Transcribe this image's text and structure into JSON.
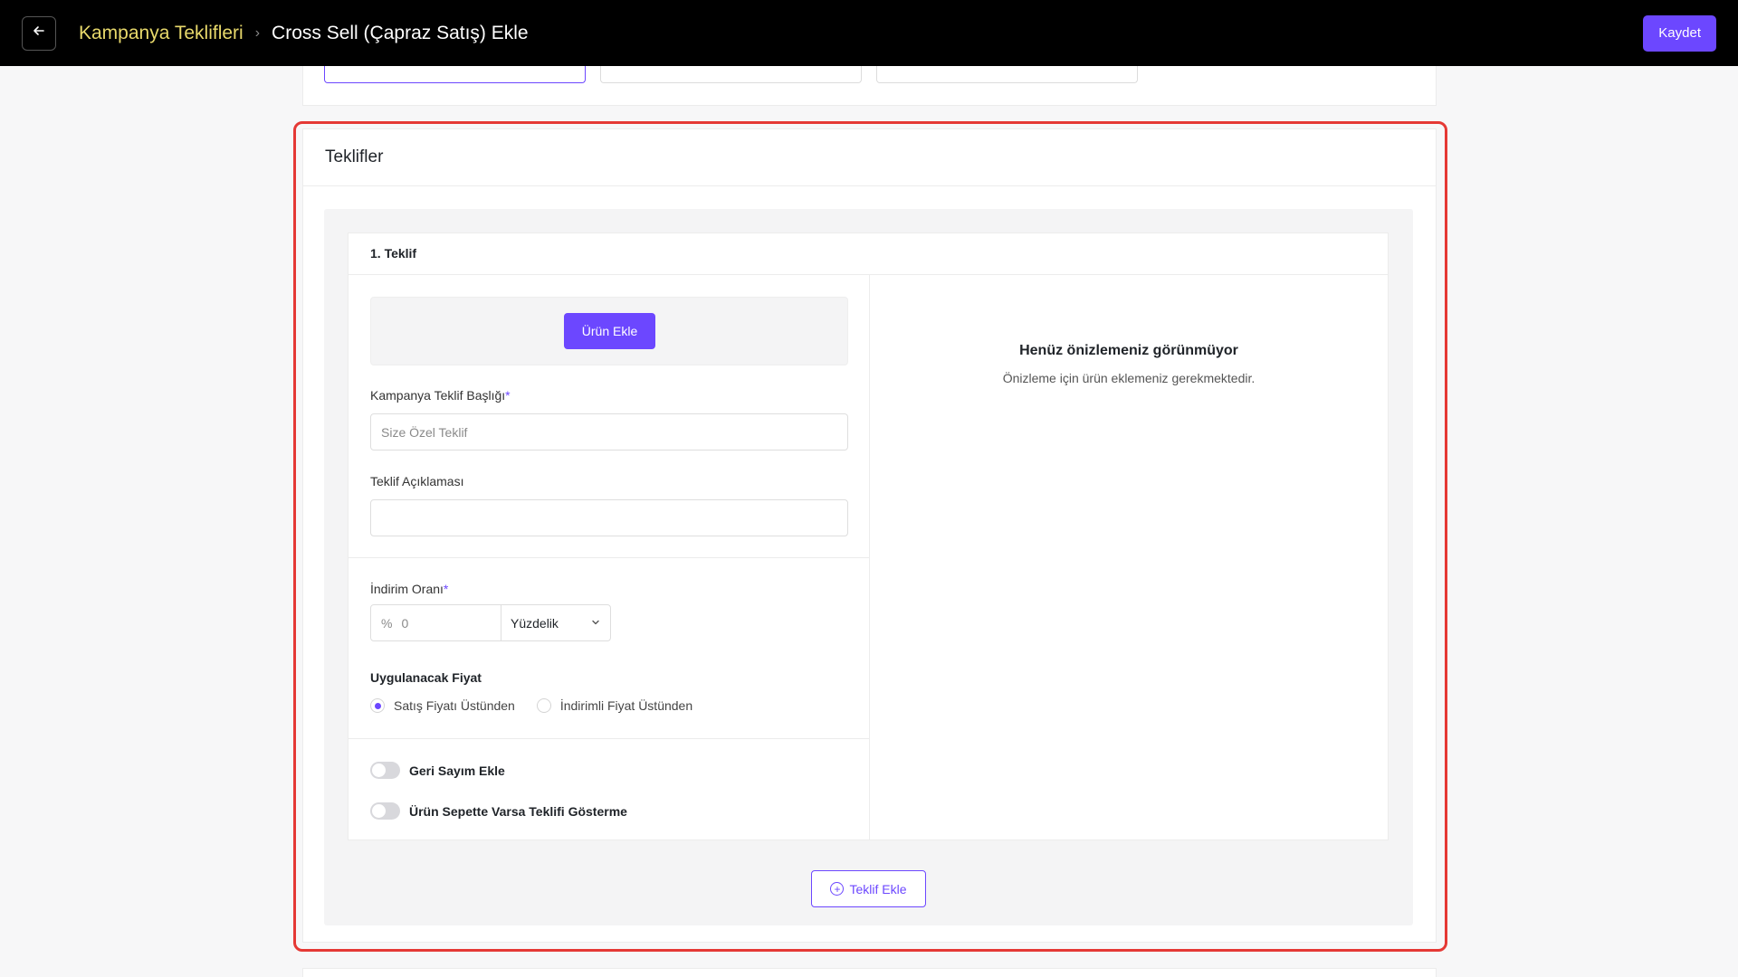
{
  "header": {
    "back_icon": "arrow-left-icon",
    "breadcrumb_parent": "Kampanya Teklifleri",
    "breadcrumb_separator": "›",
    "breadcrumb_current": "Cross Sell (Çapraz Satış) Ekle",
    "save_label": "Kaydet"
  },
  "offers_section": {
    "title": "Teklifler",
    "offer": {
      "title": "1. Teklif",
      "add_product_label": "Ürün Ekle",
      "campaign_title_label": "Kampanya Teklif Başlığı",
      "required_mark": "*",
      "campaign_title_placeholder": "Size Özel Teklif",
      "campaign_title_value": "",
      "description_label": "Teklif Açıklaması",
      "description_value": "",
      "discount_label": "İndirim Oranı",
      "discount_prefix": "%",
      "discount_value": "0",
      "discount_type_selected": "Yüzdelik",
      "price_section_title": "Uygulanacak Fiyat",
      "price_options": [
        {
          "label": "Satış Fiyatı Üstünden",
          "checked": true
        },
        {
          "label": "İndirimli Fiyat Üstünden",
          "checked": false
        }
      ],
      "toggles": [
        {
          "label": "Geri Sayım Ekle",
          "on": false
        },
        {
          "label": "Ürün Sepette Varsa Teklifi Gösterme",
          "on": false
        }
      ],
      "preview_title": "Henüz önizlemeniz görünmüyor",
      "preview_subtitle": "Önizleme için ürün eklemeniz gerekmektedir."
    },
    "add_offer_label": "Teklif Ekle"
  },
  "colors": {
    "accent": "#6c47ff",
    "highlight_border": "#e53935",
    "breadcrumb_link": "#e8d96b",
    "topbar_bg": "#000000"
  }
}
